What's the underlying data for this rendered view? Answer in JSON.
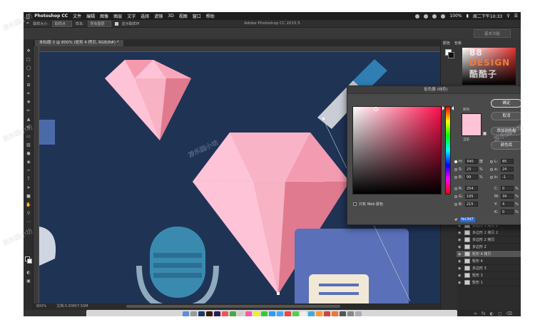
{
  "menubar": {
    "app": "Photoshop CC",
    "items": [
      "文件",
      "编辑",
      "图像",
      "图层",
      "文字",
      "选择",
      "滤镜",
      "3D",
      "视图",
      "窗口",
      "帮助"
    ],
    "battery": "100%",
    "clock": "周二下午10:33"
  },
  "window_title": "Adobe Photoshop CC 2015.5",
  "options_bar": {
    "sample_size_label": "取样大小:",
    "sample_size_value": "取样点",
    "sample_label": "样本:",
    "sample_value": "所有图层",
    "show_ring_label": "显示取样环"
  },
  "workspace": "基本功能",
  "document_tab": "未标题-3 @ 800% (矩形 4 拷贝, RGB/8#) *",
  "statusbar": {
    "zoom": "800%",
    "doc": "文档:5.93M/7.50M"
  },
  "color_panel": {
    "tab1": "颜色",
    "tab2": "色板"
  },
  "watermark": {
    "left": "88",
    "brand": "DESIGN",
    "right": "酷酷子"
  },
  "picker": {
    "title": "拾色器 (纯色)",
    "ok": "确定",
    "cancel": "取消",
    "add_swatch": "添加到色板",
    "color_libraries": "颜色库",
    "new_label": "新的",
    "current_label": "当前",
    "web_only": "只有 Web 颜色",
    "selected_color": "#fec3d7",
    "fields": {
      "H": {
        "label": "H:",
        "value": "340",
        "unit": "度"
      },
      "S": {
        "label": "S:",
        "value": "23",
        "unit": "%"
      },
      "B": {
        "label": "B:",
        "value": "99",
        "unit": "%"
      },
      "R": {
        "label": "R:",
        "value": "254",
        "unit": ""
      },
      "G": {
        "label": "G:",
        "value": "195",
        "unit": ""
      },
      "Bl": {
        "label": "B:",
        "value": "215",
        "unit": ""
      },
      "L": {
        "label": "L:",
        "value": "85",
        "unit": ""
      },
      "a": {
        "label": "a:",
        "value": "24",
        "unit": ""
      },
      "b": {
        "label": "b:",
        "value": "-1",
        "unit": ""
      },
      "C": {
        "label": "C:",
        "value": "0",
        "unit": "%"
      },
      "M": {
        "label": "M:",
        "value": "34",
        "unit": "%"
      },
      "Y": {
        "label": "Y:",
        "value": "4",
        "unit": "%"
      },
      "K": {
        "label": "K:",
        "value": "0",
        "unit": "%"
      }
    },
    "hex_label": "#",
    "hex_value": "fec3d7"
  },
  "layers": [
    {
      "name": "多边形 1 拷贝 2",
      "selected": false
    },
    {
      "name": "多边形 2 拷贝 2",
      "selected": false
    },
    {
      "name": "多边形 2 拷贝",
      "selected": false
    },
    {
      "name": "多边形 2",
      "selected": false
    },
    {
      "name": "矩形 4 拷贝",
      "selected": true
    },
    {
      "name": "矩形 4",
      "selected": false
    },
    {
      "name": "多边形 3",
      "selected": false
    },
    {
      "name": "矩形 3",
      "selected": false
    },
    {
      "name": "矩形 1",
      "selected": false
    }
  ],
  "page_watermark": "游乐园小坊",
  "colors": {
    "canvas_bg": "#1f3355",
    "gem_light": "#fec3d7",
    "gem_mid": "#f59aae",
    "gem_dark": "#e07a8f",
    "mic": "#3a8ab0",
    "disk": "#5a70b8"
  }
}
